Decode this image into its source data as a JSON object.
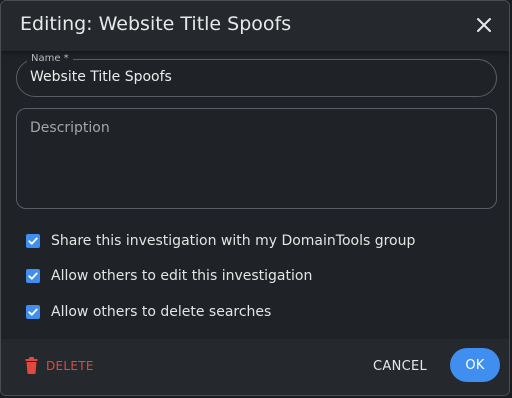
{
  "dialog": {
    "title": "Editing: Website Title Spoofs"
  },
  "name_field": {
    "label": "Name *",
    "value": "Website Title Spoofs"
  },
  "description_field": {
    "placeholder": "Description",
    "value": ""
  },
  "options": [
    {
      "label": "Share this investigation with my DomainTools group",
      "checked": true
    },
    {
      "label": "Allow others to edit this investigation",
      "checked": true
    },
    {
      "label": "Allow others to delete searches",
      "checked": true
    }
  ],
  "footer": {
    "delete_label": "DELETE",
    "cancel_label": "CANCEL",
    "ok_label": "OK"
  },
  "colors": {
    "accent": "#3f8ef0",
    "danger": "#e2483d",
    "background": "#1f2226"
  },
  "icons": {
    "close": "close-icon",
    "delete": "trash-icon",
    "checkbox": "checkmark-icon"
  }
}
